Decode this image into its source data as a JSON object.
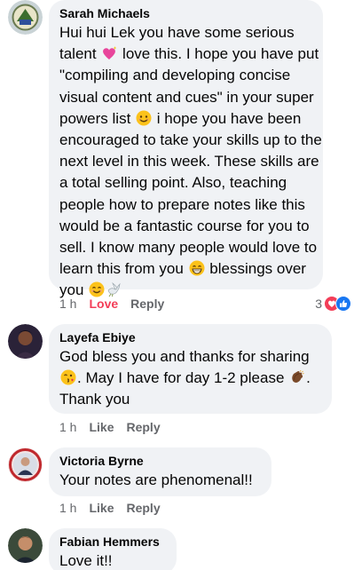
{
  "comments": [
    {
      "author": "Sarah Michaels",
      "lines": [
        "Hui hui Lek you have some serious",
        {
          "pre": "talent ",
          "emoji": "sparkling-heart-emoji",
          "post": " love this. I hope you have put"
        },
        "\"compiling and developing concise",
        "visual content and cues\" in your super",
        {
          "pre": "powers list ",
          "emoji": "smiling-face-emoji",
          "post": " i hope you have been"
        },
        "encouraged to take your skills up to the",
        "next level in this week. These skills are",
        "a total selling point. Also, teaching",
        "people how to prepare notes like this",
        "would be a fantastic course for you to",
        "sell. I know many people would love to",
        {
          "pre": "learn this from you ",
          "emoji": "grinning-face-emoji",
          "post": " blessings over"
        },
        {
          "pre": "you ",
          "emoji": "smiling-face-emoji",
          "post": "",
          "emoji2": "dove-emoji"
        }
      ],
      "time": "1 h",
      "actions": [
        "Love",
        "Reply"
      ],
      "reaction_count": "3",
      "reactions": [
        "love",
        "like"
      ]
    },
    {
      "author": "Layefa Ebiye",
      "lines": [
        "God bless you and thanks for sharing",
        {
          "pre": "",
          "emoji": "face-blowing-kiss-emoji",
          "post": ". May I have for day 1-2 please ",
          "emoji2": "clapping-hands-emoji",
          "post2": "."
        },
        "Thank you"
      ],
      "time": "1 h",
      "actions": [
        "Like",
        "Reply"
      ]
    },
    {
      "author": "Victoria Byrne",
      "lines": [
        "Your notes are phenomenal!!"
      ],
      "time": "1 h",
      "actions": [
        "Like",
        "Reply"
      ]
    },
    {
      "author": "Fabian Hemmers",
      "lines": [
        "Love it!!"
      ]
    }
  ],
  "colors": {
    "bubble": "#f0f2f5",
    "meta": "#65676b",
    "love": "#f33e58",
    "like": "#1877f2"
  }
}
